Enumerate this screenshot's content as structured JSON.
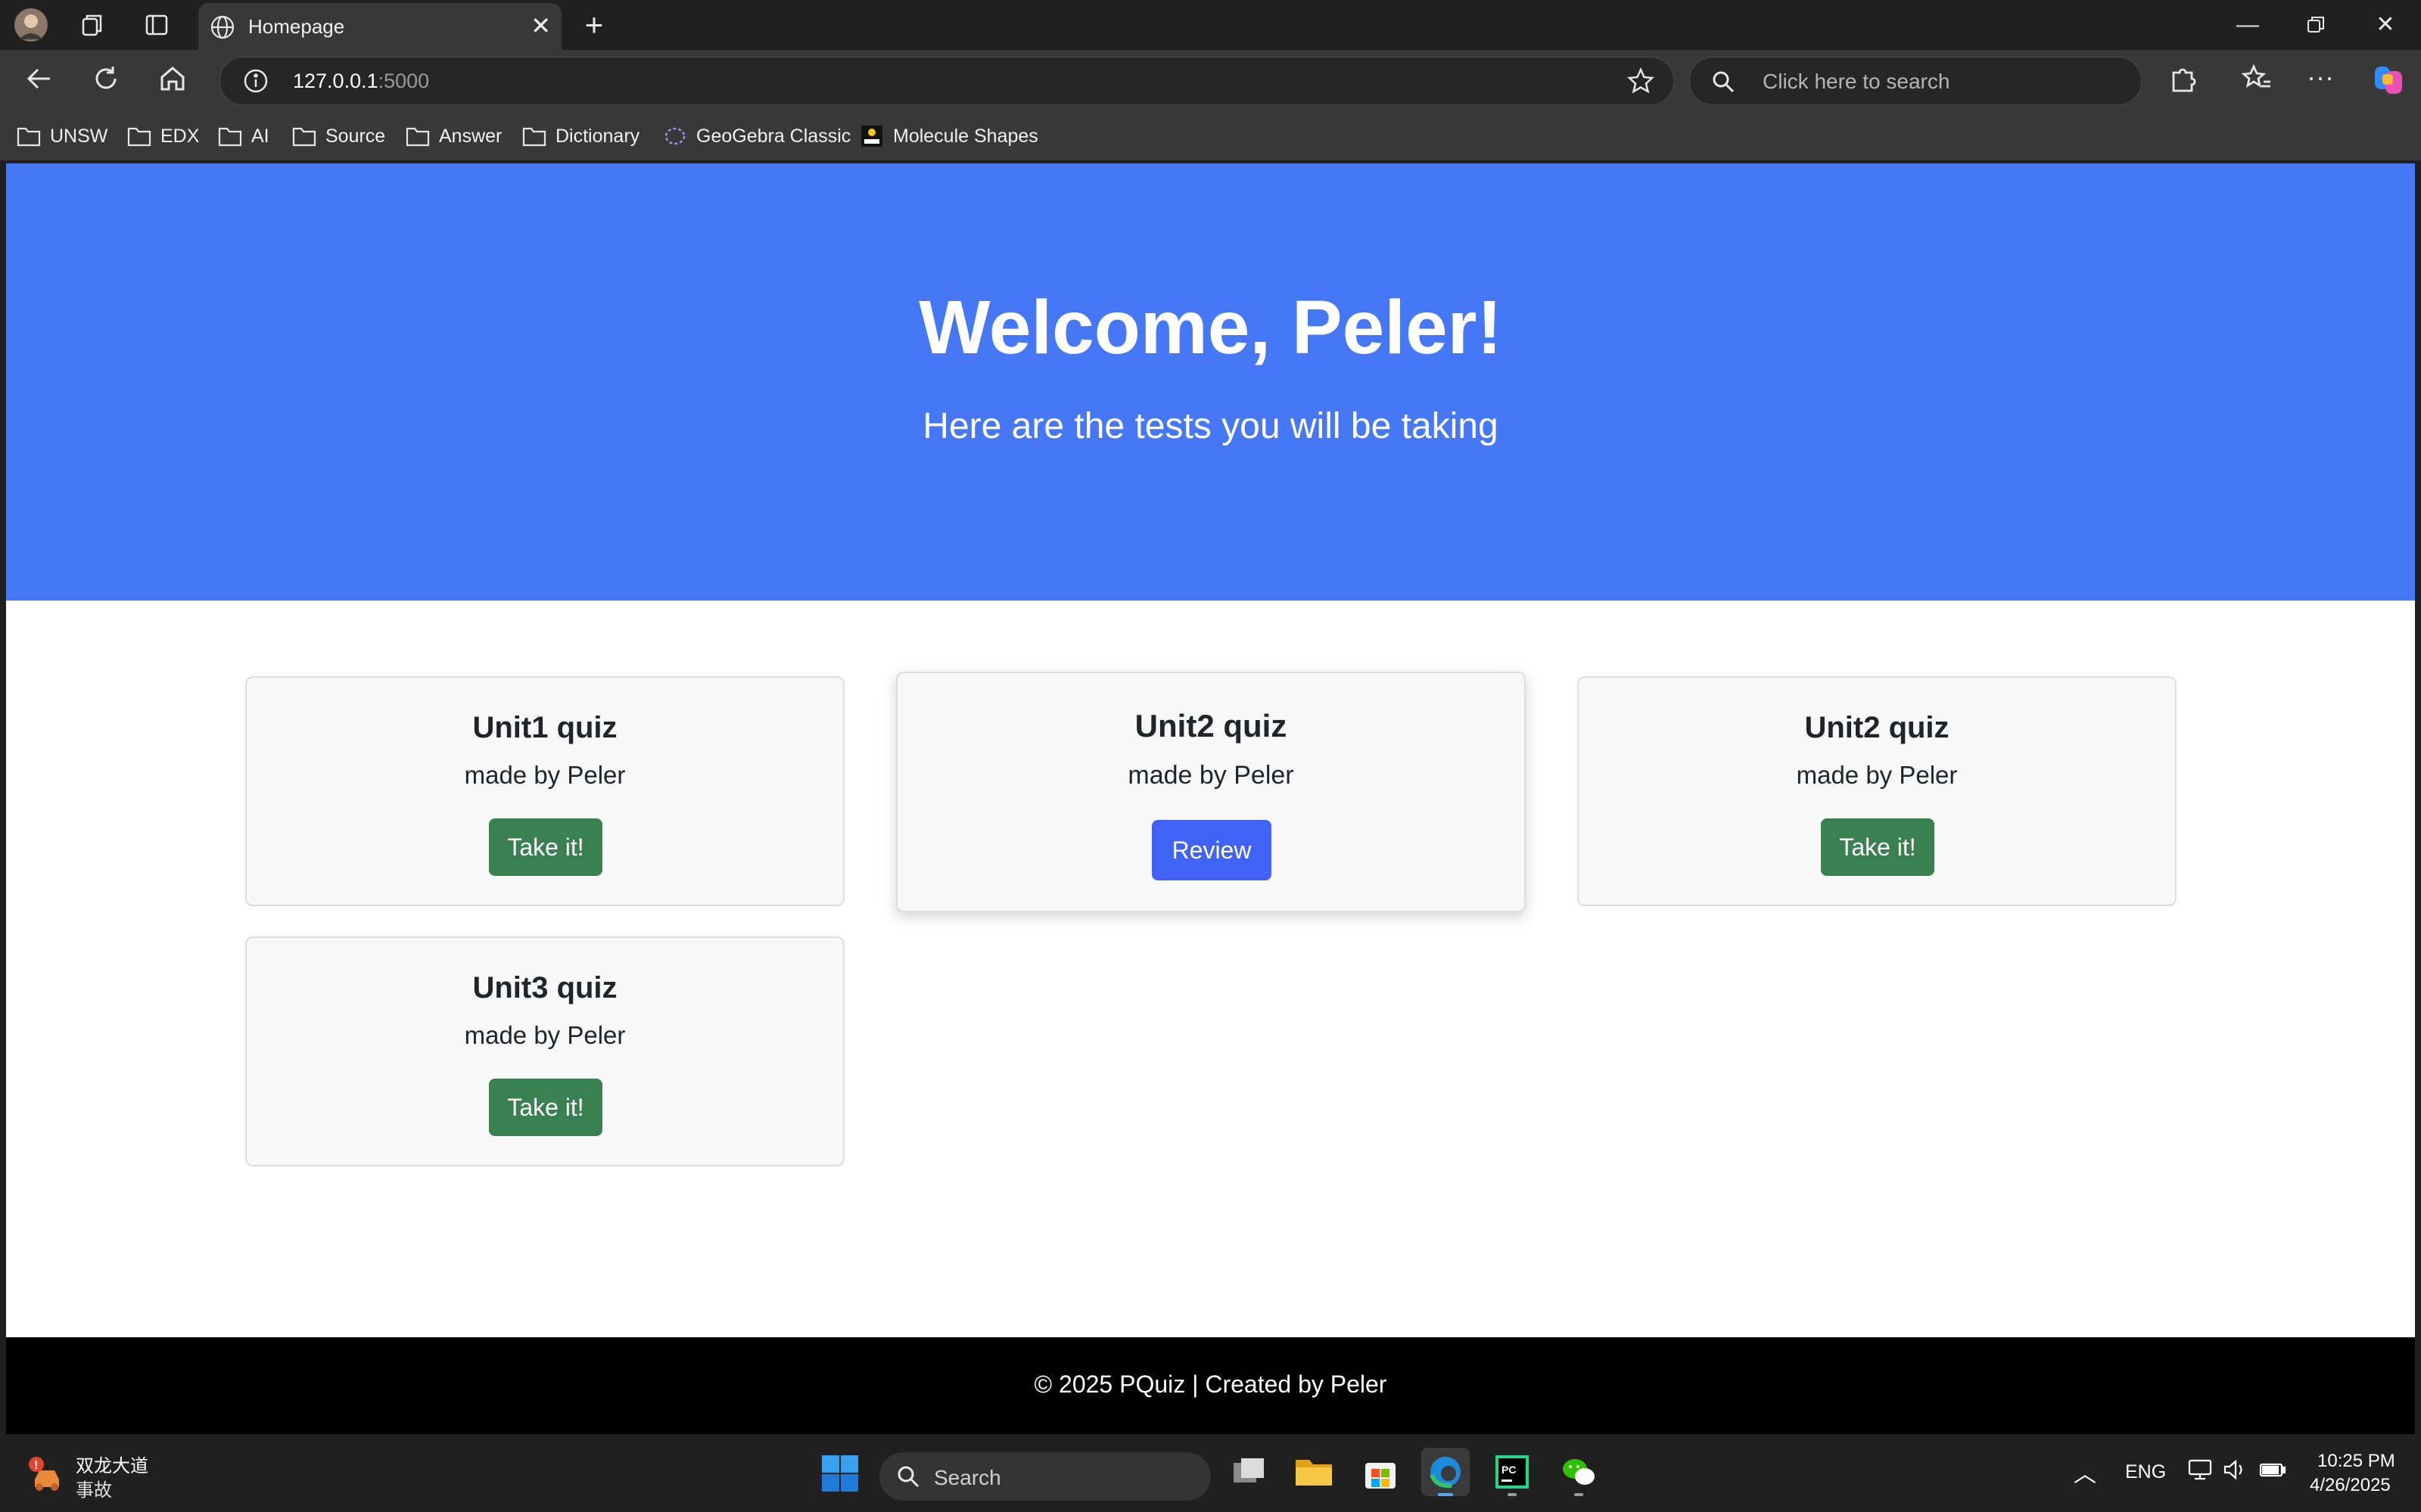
{
  "browser": {
    "tab_title": "Homepage",
    "address_host": "127.0.0.1",
    "address_port": ":5000",
    "search_placeholder": "Click here to search",
    "bookmarks": [
      "UNSW",
      "EDX",
      "AI",
      "Source",
      "Answer",
      "Dictionary",
      "GeoGebra Classic",
      "Molecule Shapes"
    ]
  },
  "hero": {
    "title": "Welcome, Peler!",
    "subtitle": "Here are the tests you will be taking"
  },
  "quizzes": [
    {
      "title": "Unit1 quiz",
      "author": "made by Peler",
      "button": "Take it!"
    },
    {
      "title": "Unit2 quiz",
      "author": "made by Peler",
      "button": "Review"
    },
    {
      "title": "Unit2 quiz",
      "author": "made by Peler",
      "button": "Take it!"
    },
    {
      "title": "Unit3 quiz",
      "author": "made by Peler",
      "button": "Take it!"
    }
  ],
  "footer": {
    "text": "© 2025 PQuiz | Created by Peler"
  },
  "taskbar": {
    "news_title": "双龙大道",
    "news_sub": "事故",
    "search_label": "Search",
    "language": "ENG",
    "time": "10:25 PM",
    "date": "4/26/2025"
  },
  "colors": {
    "hero": "#4677f5",
    "take_button": "#3a8151",
    "review_button": "#4163f5",
    "footer": "#000000"
  }
}
